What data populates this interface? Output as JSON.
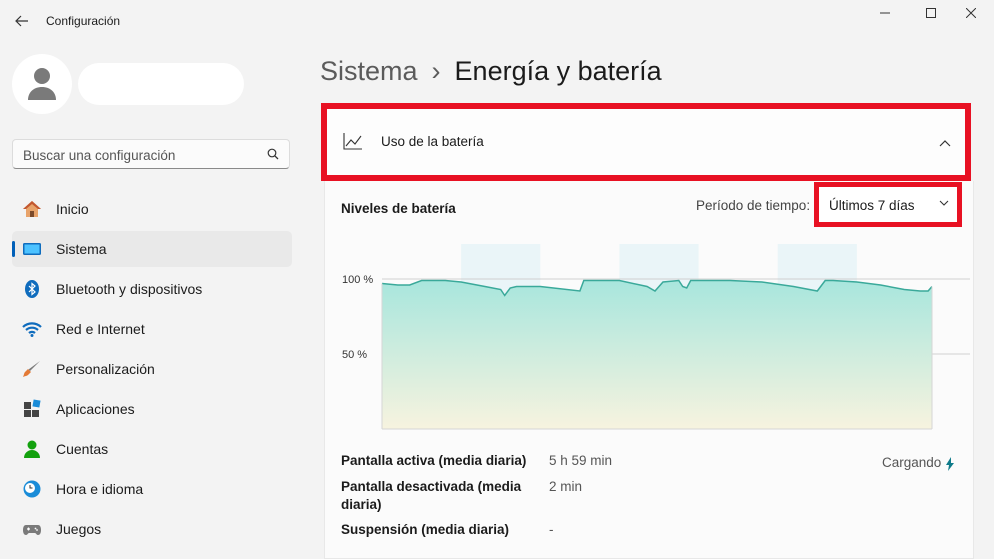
{
  "window": {
    "title": "Configuración"
  },
  "search": {
    "placeholder": "Buscar una configuración"
  },
  "sidebar": {
    "items": [
      {
        "label": "Inicio",
        "icon": "home-icon"
      },
      {
        "label": "Sistema",
        "icon": "monitor-icon",
        "selected": true
      },
      {
        "label": "Bluetooth y dispositivos",
        "icon": "bluetooth-icon"
      },
      {
        "label": "Red e Internet",
        "icon": "wifi-icon"
      },
      {
        "label": "Personalización",
        "icon": "brush-icon"
      },
      {
        "label": "Aplicaciones",
        "icon": "apps-icon"
      },
      {
        "label": "Cuentas",
        "icon": "account-icon"
      },
      {
        "label": "Hora e idioma",
        "icon": "clock-globe-icon"
      },
      {
        "label": "Juegos",
        "icon": "gamepad-icon"
      }
    ]
  },
  "breadcrumb": {
    "parent": "Sistema",
    "separator": "›",
    "current": "Energía y batería"
  },
  "battery_card": {
    "title": "Uso de la batería",
    "section_title": "Niveles de batería",
    "period_label": "Período de tiempo:",
    "period_value": "Últimos 7 días",
    "stats": [
      {
        "label": "Pantalla activa (media diaria)",
        "value": "5 h 59 min"
      },
      {
        "label": "Pantalla desactivada (media diaria)",
        "value": "2 min"
      },
      {
        "label": "Suspensión (media diaria)",
        "value": "-"
      }
    ],
    "status": "Cargando"
  },
  "colors": {
    "accent": "#005fb8",
    "highlight_border": "#e81123",
    "chart_line": "#3aa99a",
    "chart_fill_top": "#a8e6dd",
    "chart_fill_bottom": "#f7f3df",
    "day_band": "#eaf5f8"
  },
  "chart_data": {
    "type": "area",
    "ylabels": [
      "100 %",
      "50 %"
    ],
    "ylim": [
      0,
      100
    ],
    "xlim": [
      0,
      7
    ],
    "x": [
      0,
      0.2,
      0.35,
      0.5,
      0.8,
      1.0,
      1.3,
      1.5,
      1.55,
      1.62,
      1.7,
      2.0,
      2.5,
      2.55,
      2.65,
      3.0,
      3.35,
      3.45,
      3.55,
      3.75,
      3.8,
      3.85,
      3.9,
      4.2,
      4.4,
      4.8,
      5.2,
      5.5,
      5.6,
      5.7,
      6.0,
      6.3,
      6.6,
      6.8,
      6.9,
      6.95
    ],
    "y": [
      97,
      96,
      96,
      99,
      99,
      98,
      95,
      93,
      89,
      94,
      95,
      95,
      92,
      99,
      99,
      99,
      95,
      92,
      98,
      99,
      95,
      94,
      99,
      99,
      99,
      98,
      95,
      92,
      99,
      99,
      98,
      96,
      93,
      92,
      92,
      95
    ],
    "day_bands": [
      [
        1,
        2
      ],
      [
        3,
        4
      ],
      [
        5,
        6
      ]
    ]
  }
}
